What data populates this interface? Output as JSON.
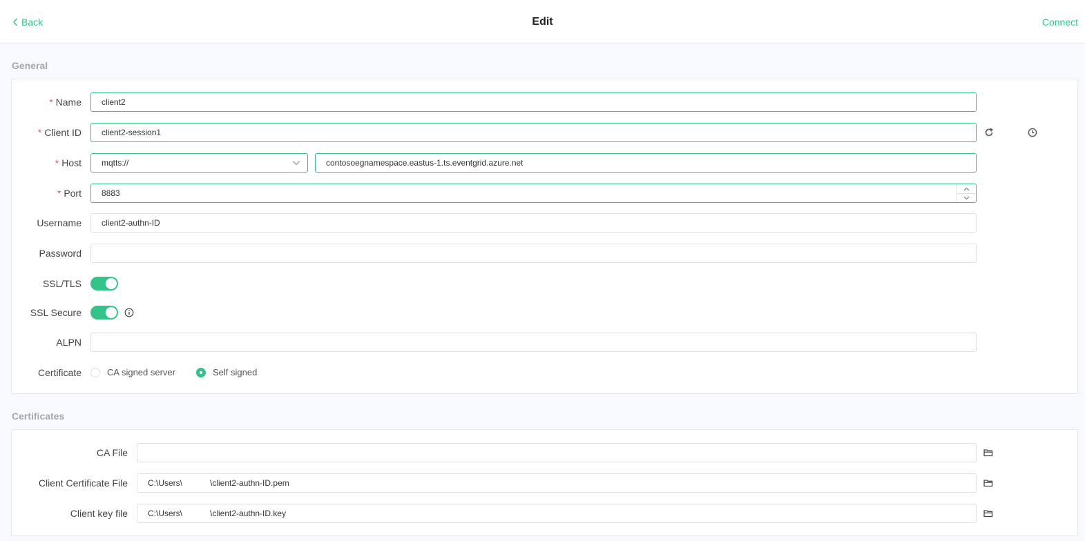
{
  "header": {
    "back_label": "Back",
    "title": "Edit",
    "connect_label": "Connect"
  },
  "general": {
    "section_title": "General",
    "name": {
      "label": "Name",
      "value": "client2",
      "required": true
    },
    "client_id": {
      "label": "Client ID",
      "value": "client2-session1",
      "required": true
    },
    "host": {
      "label": "Host",
      "protocol": "mqtts://",
      "value": "contosoegnamespace.eastus-1.ts.eventgrid.azure.net",
      "required": true
    },
    "port": {
      "label": "Port",
      "value": "8883",
      "required": true
    },
    "username": {
      "label": "Username",
      "value": "client2-authn-ID"
    },
    "password": {
      "label": "Password",
      "value": ""
    },
    "ssl_tls": {
      "label": "SSL/TLS",
      "enabled": true
    },
    "ssl_secure": {
      "label": "SSL Secure",
      "enabled": true
    },
    "alpn": {
      "label": "ALPN",
      "value": ""
    },
    "certificate": {
      "label": "Certificate",
      "options": [
        "CA signed server",
        "Self signed"
      ],
      "selected": "Self signed"
    },
    "required_mark": "*"
  },
  "certificates": {
    "section_title": "Certificates",
    "ca_file": {
      "label": "CA File",
      "value": ""
    },
    "client_cert": {
      "label": "Client Certificate File",
      "value": "C:\\Users\\            \\client2-authn-ID.pem"
    },
    "client_key": {
      "label": "Client key file",
      "value": "C:\\Users\\            \\client2-authn-ID.key"
    }
  },
  "colors": {
    "accent": "#34c388",
    "required": "#f5564e",
    "section_title": "#a3a7b0"
  },
  "icons": {
    "back": "chevron-left-icon",
    "refresh": "refresh-icon",
    "history": "clock-icon",
    "info": "info-icon",
    "folder": "folder-icon"
  }
}
